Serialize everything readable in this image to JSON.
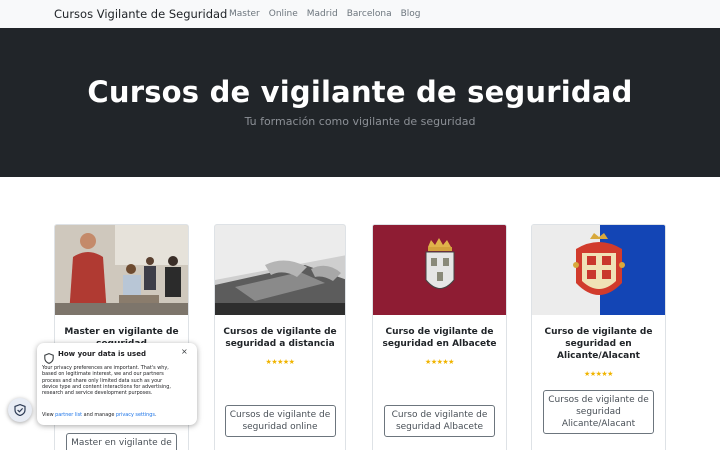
{
  "navbar": {
    "brand": "Cursos Vigilante de Seguridad",
    "links": [
      "Master",
      "Online",
      "Madrid",
      "Barcelona",
      "Blog"
    ]
  },
  "hero": {
    "title": "Cursos de vigilante de seguridad",
    "subtitle": "Tu formación como vigilante de seguridad"
  },
  "cards": [
    {
      "title": "Master en vigilante de seguridad",
      "button": "Master en vigilante de seguridad",
      "image": "classroom-photo"
    },
    {
      "title": "Cursos de vigilante de seguridad a distancia",
      "stars": "★★★★★",
      "button": "Cursos de vigilante de seguridad online",
      "image": "typing-photo"
    },
    {
      "title": "Curso de vigilante de seguridad en Albacete",
      "stars": "★★★★★",
      "button": "Curso de vigilante de seguridad Albacete",
      "image": "albacete-flag"
    },
    {
      "title": "Curso de vigilante de seguridad en Alicante/Alacant",
      "stars": "★★★★★",
      "button": "Cursos de vigilante de seguridad Alicante/Alacant",
      "image": "alicante-flag"
    }
  ],
  "cookie": {
    "title": "How your data is used",
    "body": "Your privacy preferences are important. That's why, based on legitimate interest, we and our partners process and share only limited data such as your device type and content interactions for advertising, research and service development purposes.",
    "footer_prefix": "View",
    "partner_link": "partner list",
    "footer_mid": "and manage",
    "settings_link": "privacy settings",
    "footer_suffix": ".",
    "close": "×"
  },
  "colors": {
    "hero_bg": "#212529",
    "navbar_bg": "#f8f9fa",
    "star": "#f0b400",
    "link": "#1a73e8"
  }
}
